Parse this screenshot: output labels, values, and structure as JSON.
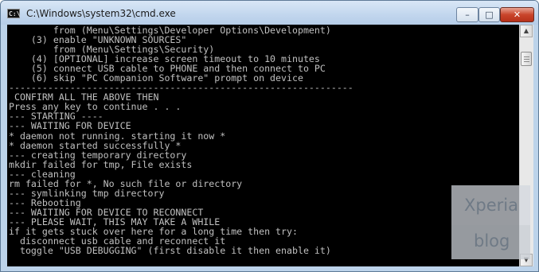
{
  "window": {
    "title": "C:\\Windows\\system32\\cmd.exe",
    "icon_label": "C:\\",
    "controls": {
      "minimize": "–",
      "maximize": "□",
      "close": "✕"
    }
  },
  "console": {
    "lines": [
      "        from (Menu\\Settings\\Developer Options\\Development)",
      "    (3) enable \"UNKNOWN SOURCES\"",
      "        from (Menu\\Settings\\Security)",
      "    (4) [OPTIONAL] increase screen timeout to 10 minutes",
      "    (5) connect USB cable to PHONE and then connect to PC",
      "    (6) skip \"PC Companion Software\" prompt on device",
      "--------------------------------------------------------------",
      " CONFIRM ALL THE ABOVE THEN",
      "Press any key to continue . . .",
      "--- STARTING ----",
      "--- WAITING FOR DEVICE",
      "* daemon not running. starting it now *",
      "* daemon started successfully *",
      "--- creating temporary directory",
      "mkdir failed for tmp, File exists",
      "--- cleaning",
      "rm failed for *, No such file or directory",
      "--- symlinking tmp directory",
      "--- Rebooting",
      "--- WAITING FOR DEVICE TO RECONNECT",
      "--- PLEASE WAIT, THIS MAY TAKE A WHILE",
      "if it gets stuck over here for a long time then try:",
      "  disconnect usb cable and reconnect it",
      "  toggle \"USB DEBUGGING\" (first disable it then enable it)"
    ]
  },
  "scrollbar": {
    "up_arrow": "▲",
    "down_arrow": "▼"
  },
  "watermark": {
    "line1": "Xperia",
    "line2": "blog"
  },
  "colors": {
    "console_bg": "#000000",
    "console_text": "#c0c0c0",
    "titlebar": "#c3d7ee",
    "close_button": "#c9452b"
  }
}
